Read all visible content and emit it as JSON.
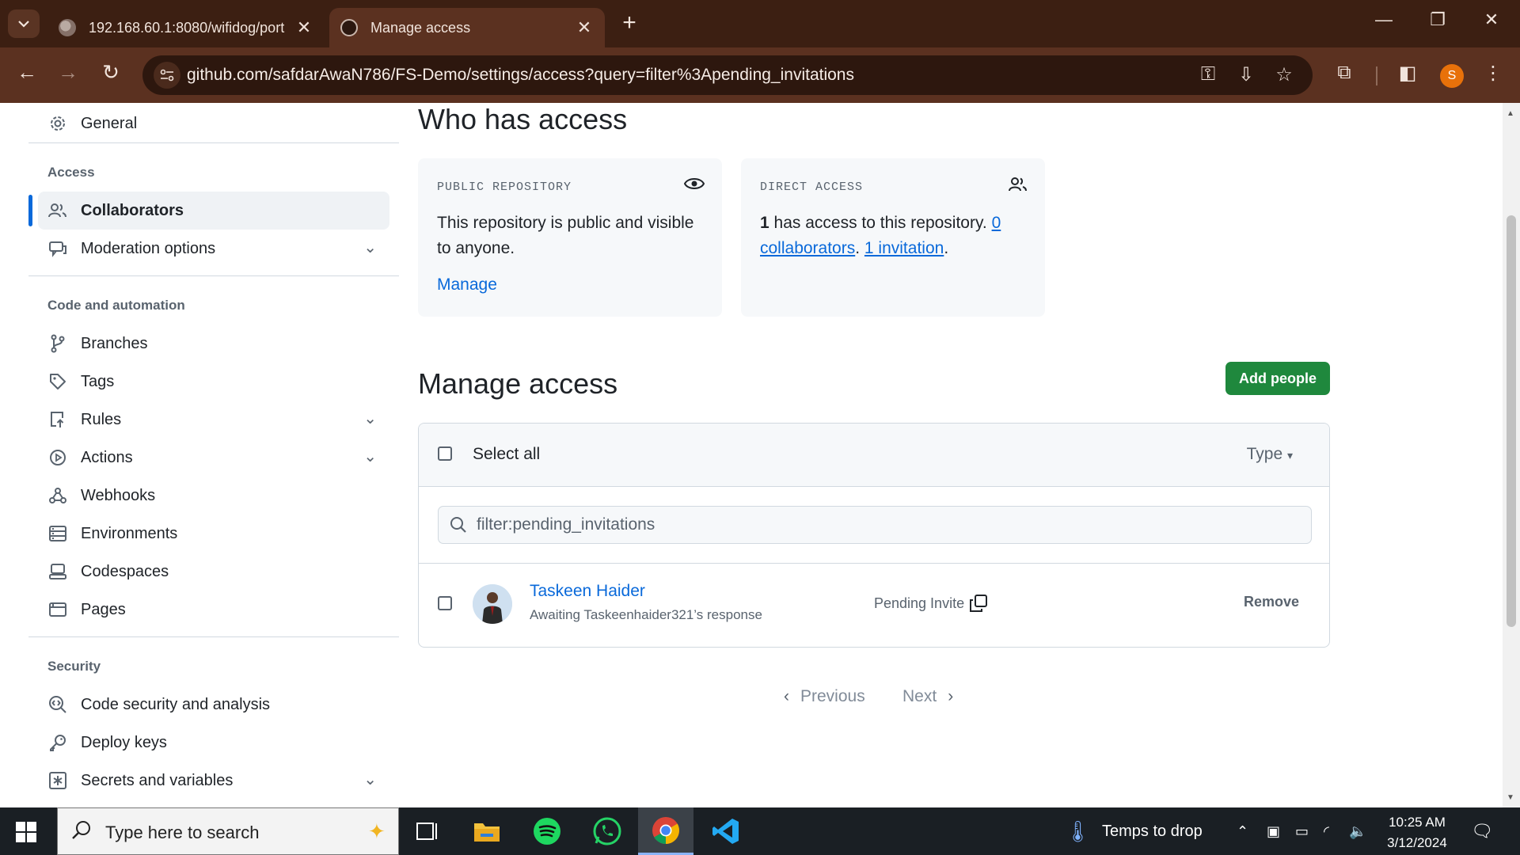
{
  "browser": {
    "tabs": [
      {
        "title": "192.168.60.1:8080/wifidog/port",
        "active": false
      },
      {
        "title": "Manage access",
        "active": true
      }
    ],
    "url": "github.com/safdarAwaN786/FS-Demo/settings/access?query=filter%3Apending_invitations",
    "profile_initial": "S"
  },
  "sidebar": {
    "general": "General",
    "access_heading": "Access",
    "collaborators": "Collaborators",
    "moderation": "Moderation options",
    "code_heading": "Code and automation",
    "branches": "Branches",
    "tags": "Tags",
    "rules": "Rules",
    "actions": "Actions",
    "webhooks": "Webhooks",
    "environments": "Environments",
    "codespaces": "Codespaces",
    "pages": "Pages",
    "security_heading": "Security",
    "code_security": "Code security and analysis",
    "deploy_keys": "Deploy keys",
    "secrets": "Secrets and variables"
  },
  "who": {
    "title": "Who has access",
    "public_label": "PUBLIC REPOSITORY",
    "public_text": "This repository is public and visible to anyone.",
    "manage": "Manage",
    "direct_label": "DIRECT ACCESS",
    "direct_count": "1",
    "direct_text": " has access to this repository. ",
    "collab_link": "0 collaborators",
    "sep": ". ",
    "invite_link": "1 invitation",
    "end": "."
  },
  "manage": {
    "title": "Manage access",
    "add_people": "Add people",
    "select_all": "Select all",
    "type": "Type",
    "search_value": "filter:pending_invitations",
    "user_name": "Taskeen Haider",
    "user_sub": "Awaiting Taskeenhaider321’s response",
    "pending": "Pending Invite",
    "remove": "Remove",
    "previous": "Previous",
    "next": "Next"
  },
  "taskbar": {
    "search_placeholder": "Type here to search",
    "weather": "Temps to drop",
    "time": "10:25 AM",
    "date": "3/12/2024"
  },
  "colors": {
    "accent": "#0969da",
    "green": "#1f883d",
    "browser_frame": "#3c1f12"
  }
}
